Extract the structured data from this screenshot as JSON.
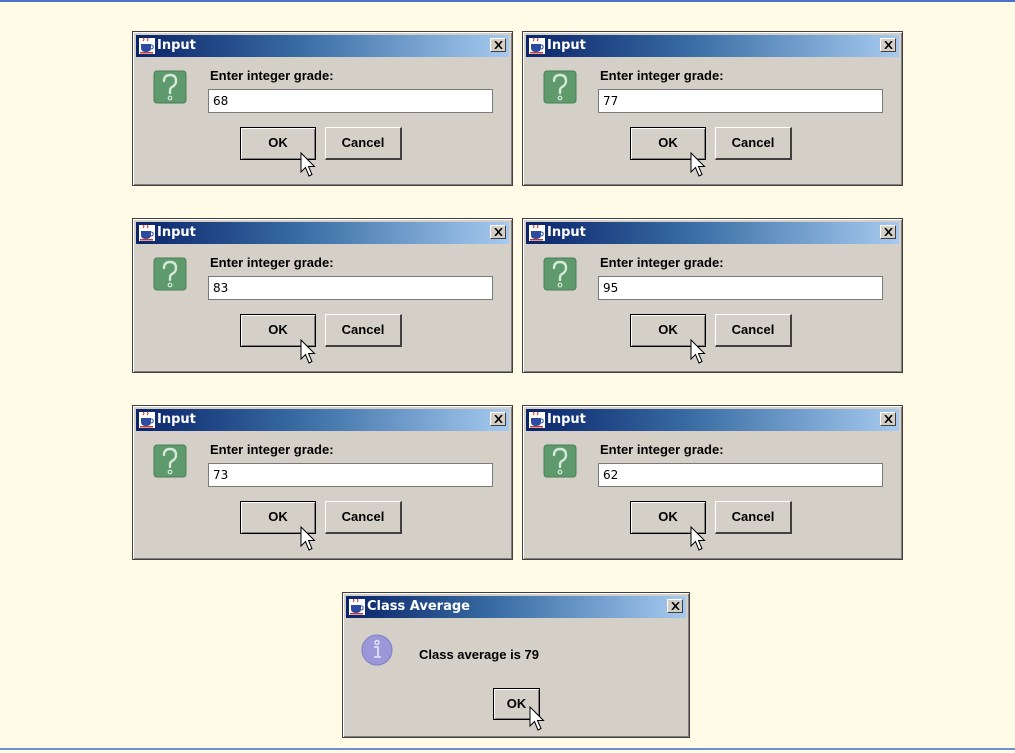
{
  "dialogs": [
    {
      "title": "Input",
      "prompt": "Enter integer grade:",
      "value": "68",
      "ok_label": "OK",
      "cancel_label": "Cancel"
    },
    {
      "title": "Input",
      "prompt": "Enter integer grade:",
      "value": "77",
      "ok_label": "OK",
      "cancel_label": "Cancel"
    },
    {
      "title": "Input",
      "prompt": "Enter integer grade:",
      "value": "83",
      "ok_label": "OK",
      "cancel_label": "Cancel"
    },
    {
      "title": "Input",
      "prompt": "Enter integer grade:",
      "value": "95",
      "ok_label": "OK",
      "cancel_label": "Cancel"
    },
    {
      "title": "Input",
      "prompt": "Enter integer grade:",
      "value": "73",
      "ok_label": "OK",
      "cancel_label": "Cancel"
    },
    {
      "title": "Input",
      "prompt": "Enter integer grade:",
      "value": "62",
      "ok_label": "OK",
      "cancel_label": "Cancel"
    }
  ],
  "class_average": {
    "title": "Class Average",
    "message": "Class average is 79",
    "ok_label": "OK"
  },
  "icons": {
    "app": "java-cup-icon",
    "close": "close-icon",
    "question": "question-icon",
    "info": "info-icon",
    "cursor": "mouse-pointer-icon"
  },
  "colors": {
    "page_background": "#fffbe6",
    "title_bar_start": "#0a246a",
    "title_bar_end": "#a6caf0",
    "dialog_face": "#d4d0c8",
    "question_icon": "#5e9a6c",
    "info_icon": "#9a98d8"
  }
}
